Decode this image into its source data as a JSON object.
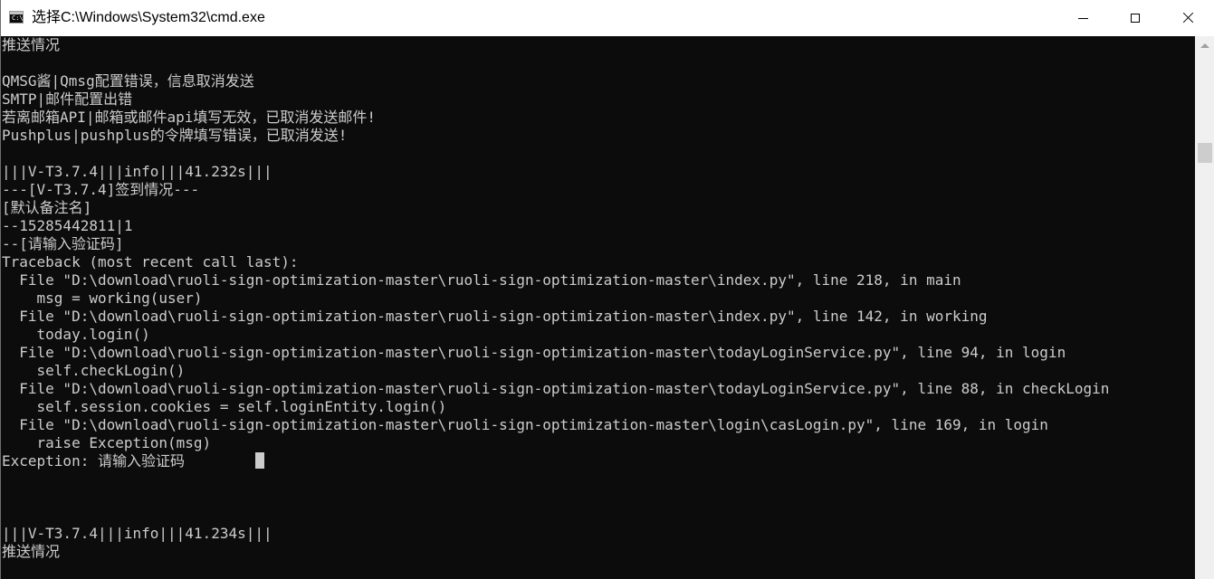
{
  "window": {
    "title": "选择C:\\Windows\\System32\\cmd.exe",
    "icon": "cmd-icon",
    "icon_prompt": "C:\\"
  },
  "console": {
    "lines": [
      "推送情况",
      "",
      "QMSG酱|Qmsg配置错误，信息取消发送",
      "SMTP|邮件配置出错",
      "若离邮箱API|邮箱或邮件api填写无效，已取消发送邮件!",
      "Pushplus|pushplus的令牌填写错误，已取消发送!",
      "",
      "|||V-T3.7.4|||info|||41.232s|||",
      "---[V-T3.7.4]签到情况---",
      "[默认备注名]",
      "--15285442811|1",
      "--[请输入验证码]",
      "Traceback (most recent call last):",
      "  File \"D:\\download\\ruoli-sign-optimization-master\\ruoli-sign-optimization-master\\index.py\", line 218, in main",
      "    msg = working(user)",
      "  File \"D:\\download\\ruoli-sign-optimization-master\\ruoli-sign-optimization-master\\index.py\", line 142, in working",
      "    today.login()",
      "  File \"D:\\download\\ruoli-sign-optimization-master\\ruoli-sign-optimization-master\\todayLoginService.py\", line 94, in login",
      "    self.checkLogin()",
      "  File \"D:\\download\\ruoli-sign-optimization-master\\ruoli-sign-optimization-master\\todayLoginService.py\", line 88, in checkLogin",
      "    self.session.cookies = self.loginEntity.login()",
      "  File \"D:\\download\\ruoli-sign-optimization-master\\ruoli-sign-optimization-master\\login\\casLogin.py\", line 169, in login",
      "    raise Exception(msg)",
      "Exception: 请输入验证码",
      "",
      "",
      "",
      "|||V-T3.7.4|||info|||41.234s|||",
      "推送情况"
    ]
  },
  "colors": {
    "console_bg": "#0c0c0c",
    "console_text": "#cccccc",
    "titlebar_bg": "#ffffff"
  }
}
